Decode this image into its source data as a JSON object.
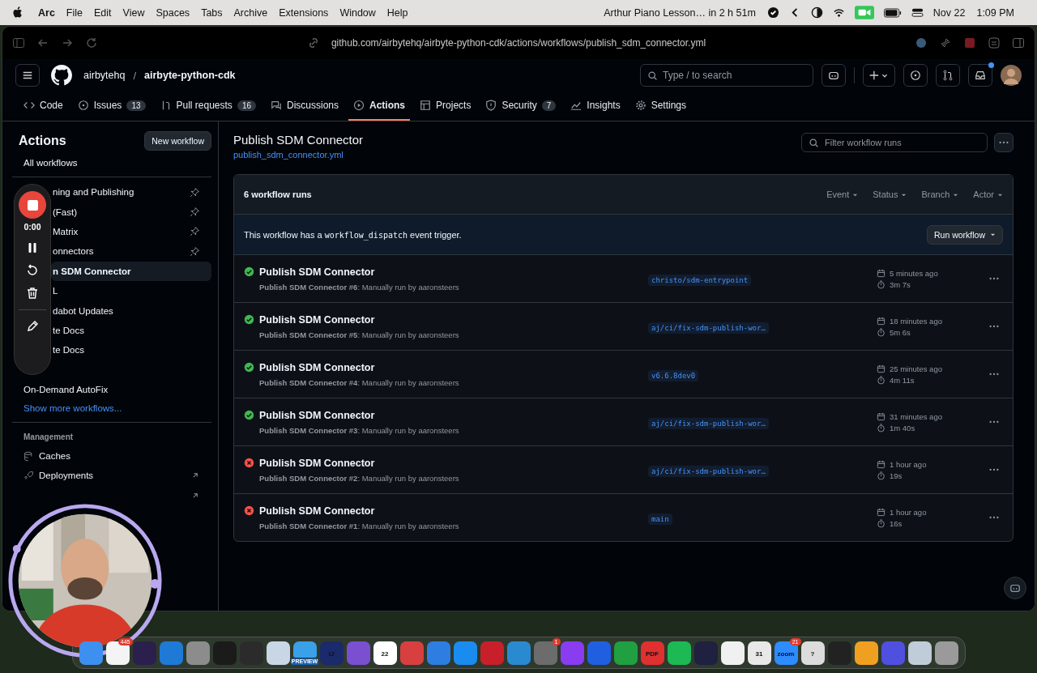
{
  "menu_bar": {
    "app": "Arc",
    "items": [
      "File",
      "Edit",
      "View",
      "Spaces",
      "Tabs",
      "Archive",
      "Extensions",
      "Window",
      "Help"
    ],
    "event": "Arthur Piano Lesson… in 2 h 51m",
    "date": "Nov 22",
    "time": "1:09 PM"
  },
  "browser": {
    "url": "github.com/airbytehq/airbyte-python-cdk/actions/workflows/publish_sdm_connector.yml"
  },
  "repo": {
    "owner": "airbytehq",
    "separator": "/",
    "name": "airbyte-python-cdk",
    "search_placeholder": "Type / to search"
  },
  "repo_tabs": [
    {
      "label": "Code",
      "selected": false
    },
    {
      "label": "Issues",
      "count": "13",
      "selected": false
    },
    {
      "label": "Pull requests",
      "count": "16",
      "selected": false
    },
    {
      "label": "Discussions",
      "selected": false
    },
    {
      "label": "Actions",
      "selected": true
    },
    {
      "label": "Projects",
      "selected": false
    },
    {
      "label": "Security",
      "count": "7",
      "selected": false
    },
    {
      "label": "Insights",
      "selected": false
    },
    {
      "label": "Settings",
      "selected": false
    }
  ],
  "sidebar": {
    "title": "Actions",
    "new_button": "New workflow",
    "all": "All workflows",
    "workflows": [
      {
        "label": "ning and Publishing",
        "kind": "covered",
        "pinned": true,
        "selected": false
      },
      {
        "label": "(Fast)",
        "kind": "covered",
        "pinned": true,
        "selected": false
      },
      {
        "label": "Matrix",
        "kind": "covered",
        "pinned": true,
        "selected": false
      },
      {
        "label": "onnectors",
        "kind": "covered",
        "pinned": true,
        "selected": false
      },
      {
        "label": "n SDM Connector",
        "kind": "covered",
        "pinned": false,
        "selected": true
      },
      {
        "label": "L",
        "kind": "covered",
        "pinned": false,
        "selected": false
      },
      {
        "label": "dabot Updates",
        "kind": "covered",
        "pinned": false,
        "selected": false
      },
      {
        "label": "te Docs",
        "kind": "covered",
        "pinned": false,
        "selected": false
      },
      {
        "label": "te Docs",
        "kind": "covered",
        "pinned": false,
        "selected": false
      },
      {
        "label": "On-Demand AutoFix",
        "kind": "plain",
        "pinned": false,
        "selected": false
      }
    ],
    "more": "Show more workflows...",
    "management_title": "Management",
    "management": [
      {
        "label": "Caches",
        "external": false
      },
      {
        "label": "Deployments",
        "external": true
      }
    ]
  },
  "recorder": {
    "timer": "0:00"
  },
  "workflow": {
    "title": "Publish SDM Connector",
    "file": "publish_sdm_connector.yml",
    "filter_placeholder": "Filter workflow runs",
    "count": "6 workflow runs",
    "filters": [
      "Event",
      "Status",
      "Branch",
      "Actor"
    ],
    "trigger_before": "This workflow has a",
    "trigger_code": "workflow_dispatch",
    "trigger_after": "event trigger.",
    "run_button": "Run workflow"
  },
  "runs": [
    {
      "kind": "success",
      "title": "Publish SDM Connector",
      "subtitle": "**Publish SDM Connector #6**: Manually run by aaronsteers",
      "branch": "christo/sdm-entrypoint",
      "when": "5 minutes ago",
      "duration": "3m 7s"
    },
    {
      "kind": "success",
      "title": "Publish SDM Connector",
      "subtitle": "**Publish SDM Connector #5**: Manually run by aaronsteers",
      "branch": "aj/ci/fix-sdm-publish-wor…",
      "when": "18 minutes ago",
      "duration": "5m 6s"
    },
    {
      "kind": "success",
      "title": "Publish SDM Connector",
      "subtitle": "**Publish SDM Connector #4**: Manually run by aaronsteers",
      "branch": "v6.6.8dev0",
      "when": "25 minutes ago",
      "duration": "4m 11s"
    },
    {
      "kind": "success",
      "title": "Publish SDM Connector",
      "subtitle": "**Publish SDM Connector #3**: Manually run by aaronsteers",
      "branch": "aj/ci/fix-sdm-publish-wor…",
      "when": "31 minutes ago",
      "duration": "1m 40s"
    },
    {
      "kind": "failure",
      "title": "Publish SDM Connector",
      "subtitle": "**Publish SDM Connector #2**: Manually run by aaronsteers",
      "branch": "aj/ci/fix-sdm-publish-wor…",
      "when": "1 hour ago",
      "duration": "19s"
    },
    {
      "kind": "failure",
      "title": "Publish SDM Connector",
      "subtitle": "**Publish SDM Connector #1**: Manually run by aaronsteers",
      "branch": "main",
      "when": "1 hour ago",
      "duration": "16s"
    }
  ],
  "dock": [
    {
      "color": "#3d8ff0"
    },
    {
      "color": "#f4f4f4",
      "badge": "445"
    },
    {
      "color": "#2a1f4d"
    },
    {
      "color": "#1f7ad6"
    },
    {
      "color": "#8c8c8c"
    },
    {
      "color": "#1b1b1b"
    },
    {
      "color": "#2b2b2b"
    },
    {
      "color": "#c9d6e6"
    },
    {
      "color": "#3aa0e8",
      "label": "PREVIEW"
    },
    {
      "color": "#1a2a6a",
      "label": "IJ"
    },
    {
      "color": "#7a4fd0"
    },
    {
      "color": "#ffffff",
      "label": "22"
    },
    {
      "color": "#d84040"
    },
    {
      "color": "#2e7de0"
    },
    {
      "color": "#1a8cf0"
    },
    {
      "color": "#c8202a"
    },
    {
      "color": "#2a8ad0"
    },
    {
      "color": "#6c6c6c",
      "badge": "1"
    },
    {
      "color": "#8a3cf0"
    },
    {
      "color": "#2060e0"
    },
    {
      "color": "#20a040"
    },
    {
      "color": "#e03030",
      "label": "PDF"
    },
    {
      "color": "#1db954"
    },
    {
      "color": "#202040"
    },
    {
      "color": "#f0f0f0"
    },
    {
      "color": "#e8e8e8",
      "label": "31"
    },
    {
      "color": "#2d8cff",
      "label": "zoom",
      "badge": "21"
    },
    {
      "color": "#dcdcdc",
      "label": "?"
    },
    {
      "color": "#222222"
    },
    {
      "color": "#f0a020"
    },
    {
      "color": "#5050e0"
    },
    {
      "color": "#c0ccd8"
    },
    {
      "color": "#9a9a9a"
    }
  ]
}
